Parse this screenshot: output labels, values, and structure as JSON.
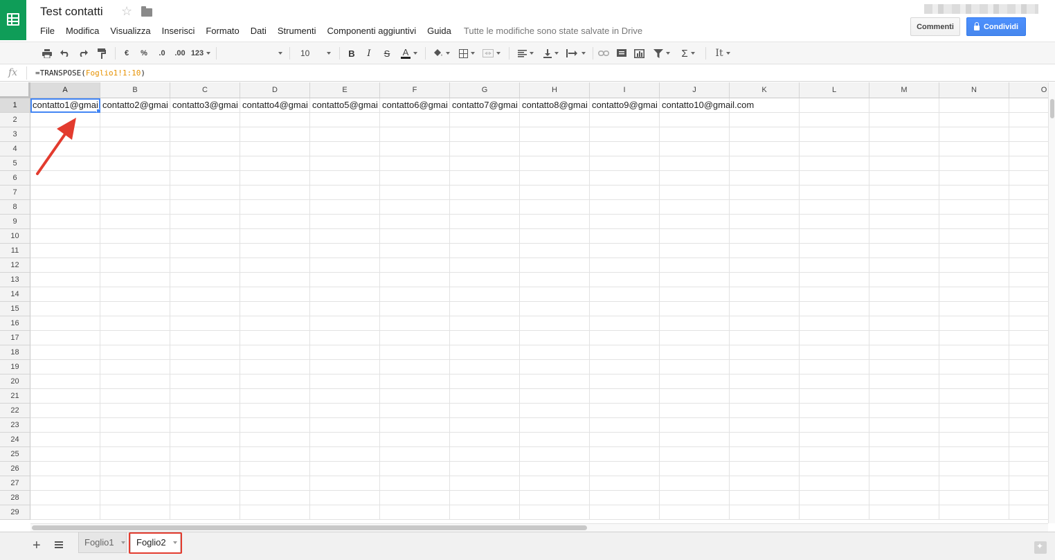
{
  "app": {
    "title": "Test contatti",
    "save_status": "Tutte le modifiche sono state salvate in Drive",
    "comments_label": "Commenti",
    "share_label": "Condividi"
  },
  "menu": [
    "File",
    "Modifica",
    "Visualizza",
    "Inserisci",
    "Formato",
    "Dati",
    "Strumenti",
    "Componenti aggiuntivi",
    "Guida"
  ],
  "toolbar": {
    "currency": "€",
    "percent": "%",
    "decrease_decimals": ".0",
    "increase_decimals": ".00",
    "more_formats": "123",
    "font_size": "10",
    "bold": "B",
    "italic": "I",
    "strikethrough": "S",
    "text_color": "A",
    "functions": "Σ",
    "input_tools": "It"
  },
  "formula": {
    "fx": "fx",
    "prefix": "=TRANSPOSE(",
    "reference": "Foglio1!1:10",
    "suffix": ")"
  },
  "columns": [
    "A",
    "B",
    "C",
    "D",
    "E",
    "F",
    "G",
    "H",
    "I",
    "J",
    "K",
    "L",
    "M",
    "N",
    "O"
  ],
  "rows": [
    "1",
    "2",
    "3",
    "4",
    "5",
    "6",
    "7",
    "8",
    "9",
    "10",
    "11",
    "12",
    "13",
    "14",
    "15",
    "16",
    "17",
    "18",
    "19",
    "20",
    "21",
    "22",
    "23",
    "24",
    "25",
    "26",
    "27",
    "28",
    "29"
  ],
  "row1_cells": [
    "contatto1@gmai",
    "contatto2@gmai",
    "contatto3@gmai",
    "contatto4@gmai",
    "contatto5@gmai",
    "contatto6@gmai",
    "contatto7@gmai",
    "contatto8@gmai",
    "contatto9@gmai",
    "contatto10@gmail.com"
  ],
  "selection": {
    "column": "A",
    "row": "1"
  },
  "sheets": [
    {
      "name": "Foglio1",
      "active": false
    },
    {
      "name": "Foglio2",
      "active": true
    }
  ],
  "colors": {
    "brand_green": "#0f9d58",
    "share_blue": "#4d90fe",
    "selection_blue": "#4285f4",
    "annotation_red": "#e33b2e",
    "formula_reference": "#e69100"
  },
  "icons": [
    "print-icon",
    "undo-icon",
    "redo-icon",
    "paint-format-icon",
    "fill-color-icon",
    "borders-icon",
    "merge-cells-icon",
    "align-horizontal-icon",
    "align-vertical-icon",
    "text-wrap-icon",
    "link-icon",
    "comment-icon",
    "chart-icon",
    "filter-icon",
    "star-icon",
    "folder-icon",
    "lock-icon",
    "add-sheet-icon",
    "all-sheets-icon",
    "explore-icon"
  ]
}
